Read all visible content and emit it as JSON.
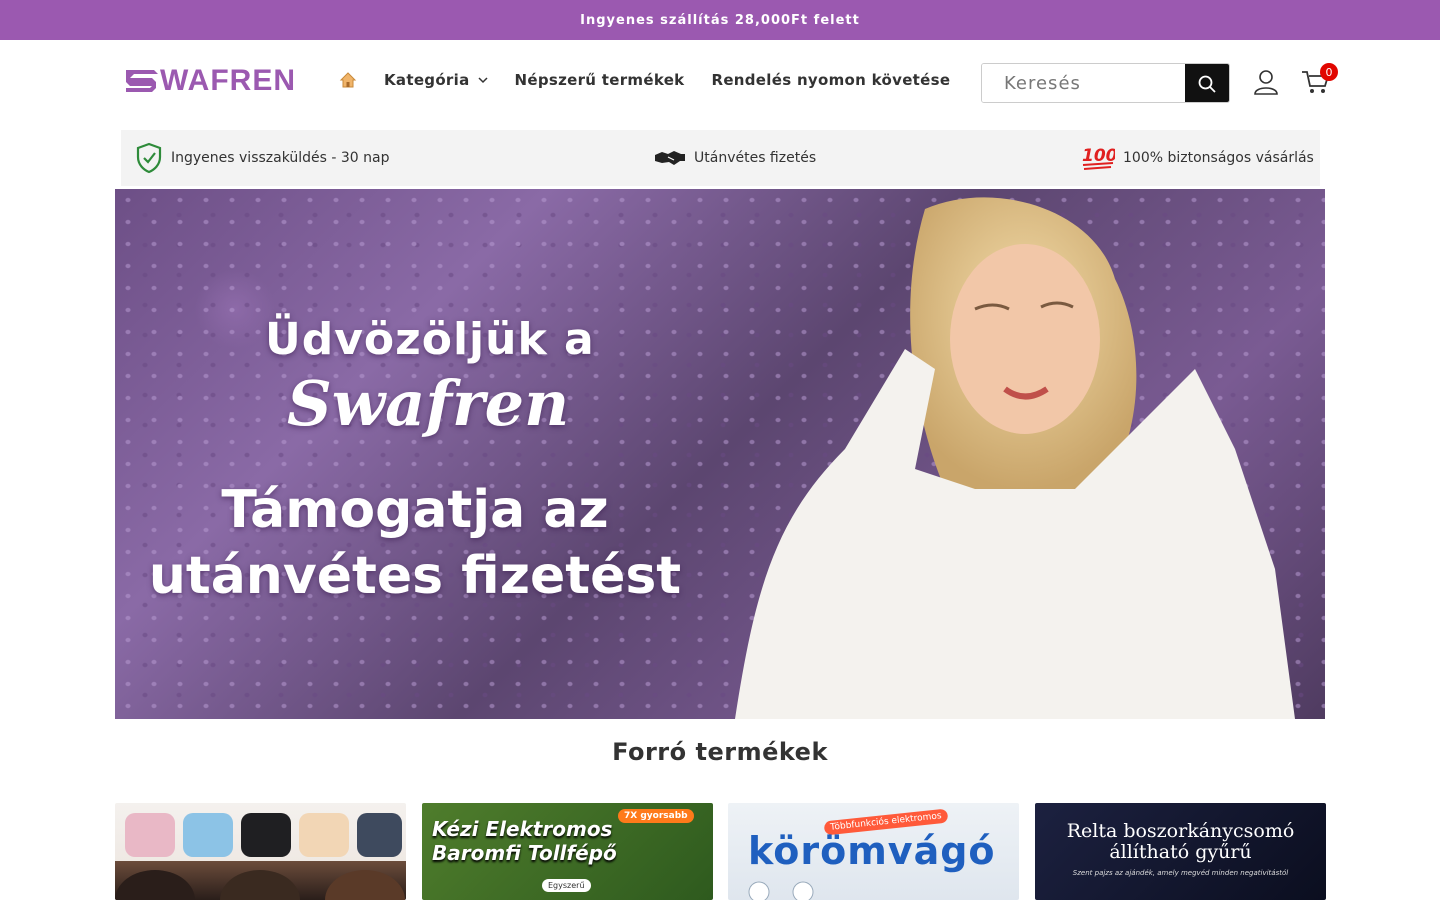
{
  "announcement": "Ingyenes szállítás 28,000Ft felett",
  "brand": {
    "name": "WAFREN",
    "color": "#9b59b0"
  },
  "nav": {
    "home_icon": "home-icon",
    "items": [
      {
        "label": "Kategória",
        "has_dropdown": true
      },
      {
        "label": "Népszerű termékek"
      },
      {
        "label": "Rendelés nyomon követése"
      }
    ]
  },
  "search": {
    "placeholder": "Keresés"
  },
  "cart": {
    "count": "0"
  },
  "trust": [
    {
      "icon": "shield-check-icon",
      "label": "Ingyenes visszaküldés - 30 nap"
    },
    {
      "icon": "handshake-icon",
      "label": "Utánvétes fizetés"
    },
    {
      "icon": "hundred-icon",
      "label": "100% biztonságos vásárlás"
    }
  ],
  "hero": {
    "line1": "Üdvözöljük a",
    "brand": "Swafren",
    "line2a": "Támogatja az",
    "line2b": "utánvétes fizetést"
  },
  "section": {
    "title": "Forró termékek"
  },
  "products": [
    {
      "name": "bra-product"
    },
    {
      "title": "Kézi Elektromos Baromfi Tollfépő",
      "badge": "7X gyorsabb",
      "tag1": "Egyszerű"
    },
    {
      "badge": "Többfunkciós elektromos",
      "title": "körömvágó"
    },
    {
      "title": "Relta boszorkánycsomó állítható gyűrű",
      "subtitle": "Szent pajzs az ajándék, amely megvéd minden negativitástól"
    }
  ]
}
